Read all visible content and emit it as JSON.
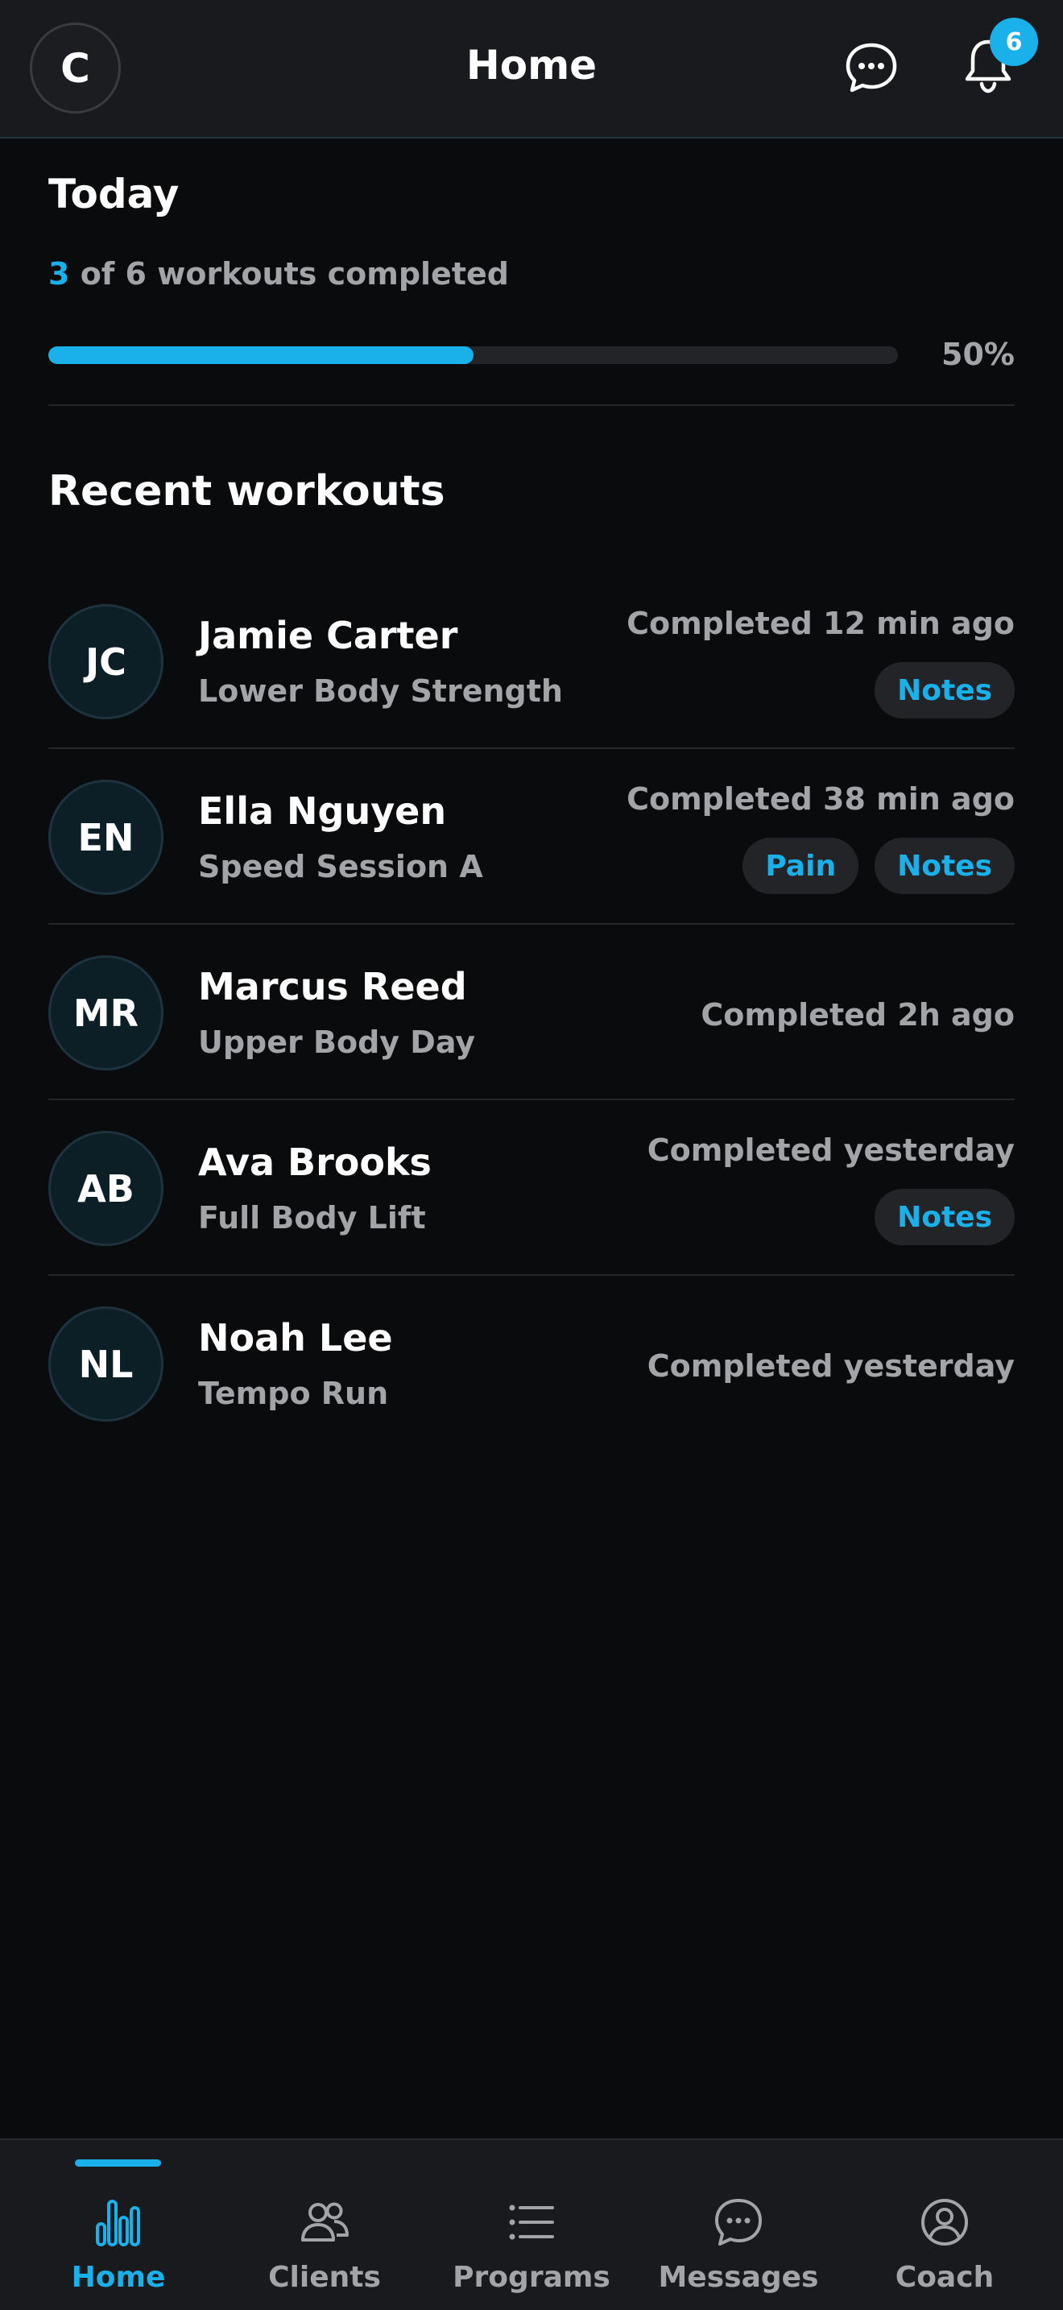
{
  "header": {
    "avatar_initial": "C",
    "title": "Home",
    "chat_icon": "chat-bubble-icon",
    "bell_icon": "bell-icon",
    "notification_count": "6"
  },
  "today": {
    "title": "Today",
    "completed_count": "3",
    "progress_suffix": "of 6 workouts completed",
    "progress_fraction": 0.5,
    "progress_label": "50%"
  },
  "recent": {
    "title": "Recent workouts",
    "items": [
      {
        "initials": "JC",
        "name": "Jamie Carter",
        "program": "Lower Body Strength",
        "status": "Completed 12 min ago",
        "tags": [
          "Notes"
        ]
      },
      {
        "initials": "EN",
        "name": "Ella Nguyen",
        "program": "Speed Session A",
        "status": "Completed 38 min ago",
        "tags": [
          "Pain",
          "Notes"
        ]
      },
      {
        "initials": "MR",
        "name": "Marcus Reed",
        "program": "Upper Body Day",
        "status": "Completed 2h ago",
        "tags": []
      },
      {
        "initials": "AB",
        "name": "Ava Brooks",
        "program": "Full Body Lift",
        "status": "Completed yesterday",
        "tags": [
          "Notes"
        ]
      },
      {
        "initials": "NL",
        "name": "Noah Lee",
        "program": "Tempo Run",
        "status": "Completed yesterday",
        "tags": []
      }
    ]
  },
  "nav": {
    "items": [
      {
        "label": "Home",
        "icon": "bar-chart-icon",
        "active": true
      },
      {
        "label": "Clients",
        "icon": "users-icon",
        "active": false
      },
      {
        "label": "Programs",
        "icon": "list-icon",
        "active": false
      },
      {
        "label": "Messages",
        "icon": "chat-bubble-icon",
        "active": false
      },
      {
        "label": "Coach",
        "icon": "user-circle-icon",
        "active": false
      }
    ]
  },
  "colors": {
    "accent": "#1ab0ea",
    "background": "#0a0b0d",
    "surface": "#191a1d",
    "muted_text": "#a3a4a8"
  }
}
